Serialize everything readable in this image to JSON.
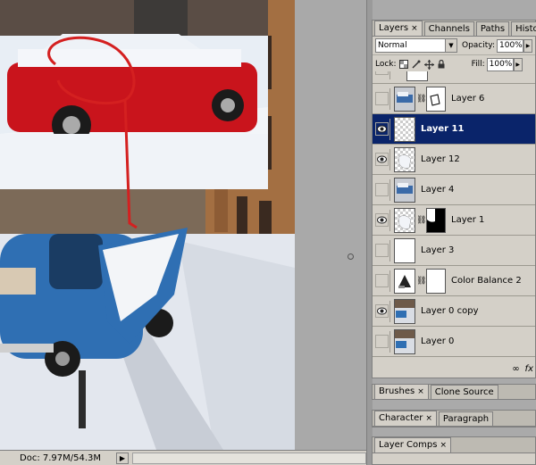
{
  "status_bar": {
    "doc_info": "Doc: 7.97M/54.3M",
    "arrow": "▶"
  },
  "layers_panel": {
    "tabs": [
      {
        "label": "Layers",
        "close": "×"
      },
      {
        "label": "Channels"
      },
      {
        "label": "Paths"
      },
      {
        "label": "History"
      }
    ],
    "blend_mode": "Normal",
    "opacity_label": "Opacity:",
    "opacity_value": "100%",
    "lock_label": "Lock:",
    "fill_label": "Fill:",
    "fill_value": "100%",
    "layers": [
      {
        "name": "Layer 6",
        "visible": false,
        "selected": false,
        "thumb": "car-clip",
        "mask": true
      },
      {
        "name": "Layer 11",
        "visible": true,
        "selected": true,
        "thumb": "transparent",
        "mask": false
      },
      {
        "name": "Layer 12",
        "visible": true,
        "selected": false,
        "thumb": "checker-snow",
        "mask": false
      },
      {
        "name": "Layer 4",
        "visible": false,
        "selected": false,
        "thumb": "car-clip",
        "mask": false
      },
      {
        "name": "Layer 1",
        "visible": true,
        "selected": false,
        "thumb": "checker-snow",
        "mask": true
      },
      {
        "name": "Layer 3",
        "visible": false,
        "selected": false,
        "thumb": "white",
        "mask": false
      },
      {
        "name": "Color Balance 2",
        "visible": false,
        "selected": false,
        "thumb": "adjustment",
        "mask": true
      },
      {
        "name": "Layer 0 copy",
        "visible": true,
        "selected": false,
        "thumb": "photo",
        "mask": false
      },
      {
        "name": "Layer 0",
        "visible": false,
        "selected": false,
        "thumb": "photo",
        "mask": false
      }
    ],
    "footer_glyph": "fx"
  },
  "brushes_panel": {
    "tabs": [
      {
        "label": "Brushes",
        "close": "×"
      },
      {
        "label": "Clone Source"
      }
    ]
  },
  "character_panel": {
    "tabs": [
      {
        "label": "Character",
        "close": "×"
      },
      {
        "label": "Paragraph"
      }
    ]
  },
  "comps_panel": {
    "tabs": [
      {
        "label": "Layer Comps",
        "close": "×"
      }
    ]
  },
  "colors": {
    "selection": "#0a246a",
    "panel": "#d4d0c8",
    "annotation_red": "#d42020"
  }
}
